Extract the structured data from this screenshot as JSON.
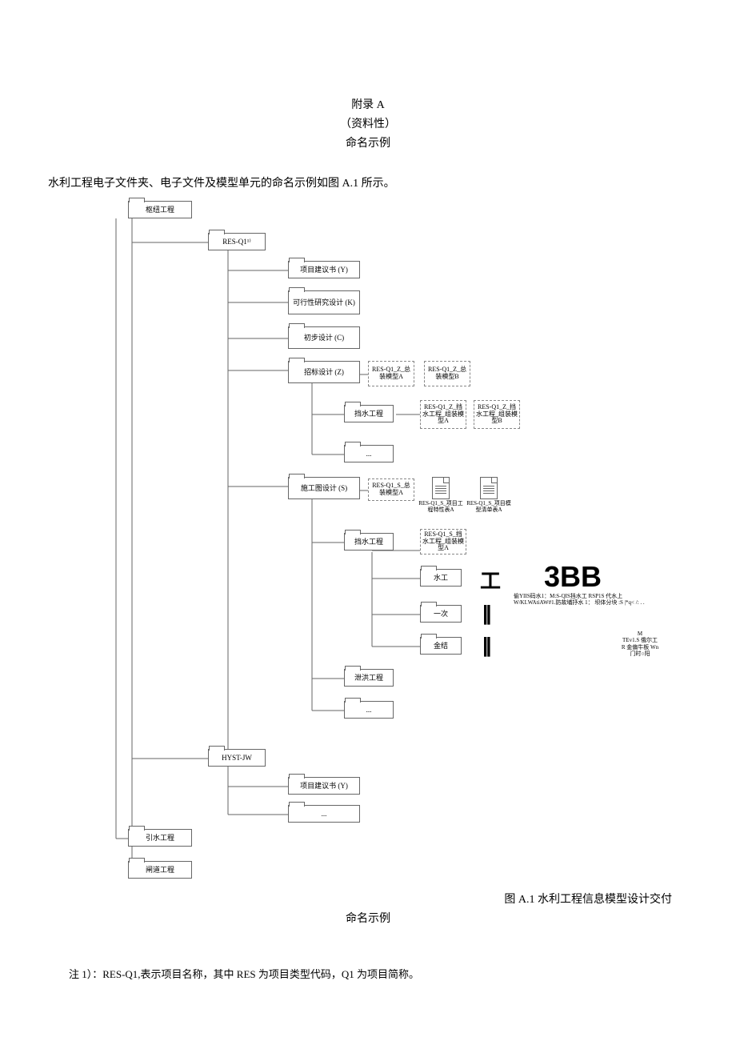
{
  "header": {
    "line1": "附录 A",
    "line2": "（资料性）",
    "line3": "命名示例"
  },
  "intro": "水利工程电子文件夹、电子文件及模型单元的命名示例如图 A.1 所示。",
  "tree": {
    "root": "枢纽工程",
    "res_q1": "RES-Q1¹⁾",
    "proposal": "项目建议书 (Y)",
    "feasibility": "可行性研究设计 (K)",
    "prelim": "初步设计 (C)",
    "bid": "招标设计 (Z)",
    "bid_model_a": "RES-Q1_Z_总装模型A",
    "bid_model_b": "RES-Q1_Z_总装模型B",
    "dam": "挡水工程",
    "dam_model_a": "RES-Q1_Z_挡水工程_组装模型A",
    "dam_model_b": "RES-Q1_Z_挡水工程_组装模型B",
    "ellipsis": "...",
    "constr": "施工图设计 (S)",
    "constr_model_a": "RES-Q1_S_总装模型A",
    "constr_spec_a": "RES-Q1_S_项目工程特性表A",
    "constr_list_a": "RES-Q1_S_项目模型清单表A",
    "constr_dam": "挡水工程",
    "constr_dam_model": "RES-Q1_S_挡水工程_组装模型A",
    "sg": "水工",
    "yd": "一次",
    "jj": "金结",
    "flood": "泄洪工程",
    "hyst": "HYST-JW",
    "hyst_proposal": "项目建议书 (Y)",
    "diversion": "引水工程",
    "gate": "闸道工程"
  },
  "chart_data": {
    "type": "tree",
    "title": "水利工程信息模型设计交付命名示例",
    "nodes": [
      {
        "id": "root",
        "label": "枢纽工程",
        "type": "folder",
        "level": 0
      },
      {
        "id": "res_q1",
        "label": "RES-Q1",
        "type": "folder",
        "level": 1,
        "parent": "root"
      },
      {
        "id": "y",
        "label": "项目建议书 (Y)",
        "type": "folder",
        "level": 2,
        "parent": "res_q1"
      },
      {
        "id": "k",
        "label": "可行性研究设计 (K)",
        "type": "folder",
        "level": 2,
        "parent": "res_q1"
      },
      {
        "id": "c",
        "label": "初步设计 (C)",
        "type": "folder",
        "level": 2,
        "parent": "res_q1"
      },
      {
        "id": "z",
        "label": "招标设计 (Z)",
        "type": "folder",
        "level": 2,
        "parent": "res_q1"
      },
      {
        "id": "z_ma",
        "label": "RES-Q1_Z_总装模型A",
        "type": "file",
        "level": 3,
        "parent": "z"
      },
      {
        "id": "z_mb",
        "label": "RES-Q1_Z_总装模型B",
        "type": "file",
        "level": 3,
        "parent": "z"
      },
      {
        "id": "z_dam",
        "label": "挡水工程",
        "type": "folder",
        "level": 3,
        "parent": "z"
      },
      {
        "id": "z_dam_a",
        "label": "RES-Q1_Z_挡水工程_组装模型A",
        "type": "file",
        "level": 4,
        "parent": "z_dam"
      },
      {
        "id": "z_dam_b",
        "label": "RES-Q1_Z_挡水工程_组装模型B",
        "type": "file",
        "level": 4,
        "parent": "z_dam"
      },
      {
        "id": "z_more",
        "label": "...",
        "type": "folder",
        "level": 3,
        "parent": "z"
      },
      {
        "id": "s",
        "label": "施工图设计 (S)",
        "type": "folder",
        "level": 2,
        "parent": "res_q1"
      },
      {
        "id": "s_ma",
        "label": "RES-Q1_S_总装模型A",
        "type": "file",
        "level": 3,
        "parent": "s"
      },
      {
        "id": "s_spec",
        "label": "RES-Q1_S_项目工程特性表A",
        "type": "doc",
        "level": 3,
        "parent": "s"
      },
      {
        "id": "s_list",
        "label": "RES-Q1_S_项目模型清单表A",
        "type": "doc",
        "level": 3,
        "parent": "s"
      },
      {
        "id": "s_dam",
        "label": "挡水工程",
        "type": "folder",
        "level": 3,
        "parent": "s"
      },
      {
        "id": "s_dam_m",
        "label": "RES-Q1_S_挡水工程_组装模型A",
        "type": "file",
        "level": 4,
        "parent": "s_dam"
      },
      {
        "id": "s_sg",
        "label": "水工",
        "type": "folder",
        "level": 4,
        "parent": "s_dam"
      },
      {
        "id": "s_yd",
        "label": "一次",
        "type": "folder",
        "level": 4,
        "parent": "s_dam"
      },
      {
        "id": "s_jj",
        "label": "金结",
        "type": "folder",
        "level": 4,
        "parent": "s_dam"
      },
      {
        "id": "s_flood",
        "label": "泄洪工程",
        "type": "folder",
        "level": 3,
        "parent": "s"
      },
      {
        "id": "s_more",
        "label": "...",
        "type": "folder",
        "level": 3,
        "parent": "s"
      },
      {
        "id": "hyst",
        "label": "HYST-JW",
        "type": "folder",
        "level": 1,
        "parent": "root"
      },
      {
        "id": "hyst_y",
        "label": "项目建议书 (Y)",
        "type": "folder",
        "level": 2,
        "parent": "hyst"
      },
      {
        "id": "hyst_more",
        "label": "...",
        "type": "folder",
        "level": 2,
        "parent": "hyst"
      },
      {
        "id": "div",
        "label": "引水工程",
        "type": "folder",
        "level": 0
      },
      {
        "id": "gate",
        "label": "闸道工程",
        "type": "folder",
        "level": 0
      }
    ]
  },
  "annotations": {
    "big": "3BB",
    "tiny1": "偷YIIS码水1：M:S-QIS挡水工 RSP1S 代水上",
    "tiny2": "W/KI.WAtiAW#1.防故埔抒水 1： 坝体分块 :S |*q< /: . .",
    "tiny3": "M",
    "tiny4": "TEv1.S 俄尔工",
    "tiny5": "R 金偏牛板 Wn",
    "tiny6": "门时○阳"
  },
  "caption": {
    "right": "图 A.1 水利工程信息模型设计交付",
    "center": "命名示例"
  },
  "footnote": "注 1）：RES-Q1,表示项目名称，其中 RES 为项目类型代码，Q1 为项目简称。"
}
